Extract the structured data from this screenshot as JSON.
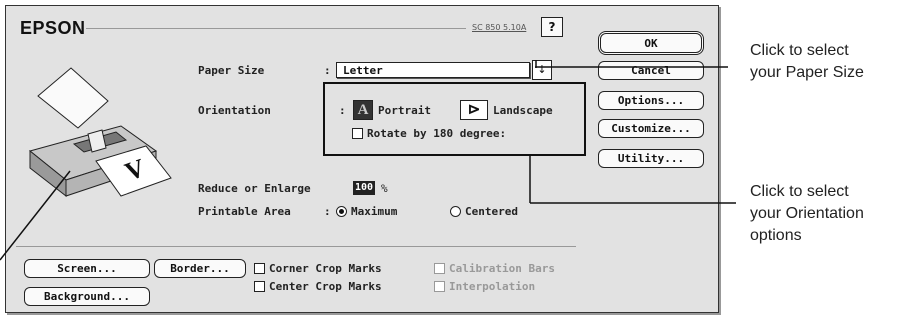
{
  "dialog": {
    "brand": "EPSON",
    "version": "SC 850 5.10A",
    "help_label": "?",
    "paper_size_label": "Paper Size",
    "paper_size_colon": ":",
    "paper_size_value": "Letter",
    "orientation_label": "Orientation",
    "orientation_colon": ":",
    "portrait_label": "Portrait",
    "landscape_label": "Landscape",
    "rotate_label": "Rotate by 180 degree:",
    "reduce_label": "Reduce or Enlarge",
    "reduce_value": "100",
    "reduce_unit": "%",
    "printable_label": "Printable Area",
    "printable_colon": ":",
    "printable_options": [
      "Maximum",
      "Centered"
    ],
    "printable_selected": "Maximum",
    "buttons": {
      "ok": "OK",
      "cancel": "Cancel",
      "options": "Options...",
      "customize": "Customize...",
      "utility": "Utility..."
    },
    "bottom": {
      "screen": "Screen...",
      "border": "Border...",
      "background": "Background...",
      "corner_crop": "Corner Crop Marks",
      "center_crop": "Center Crop Marks",
      "calibration": "Calibration Bars",
      "interpolation": "Interpolation"
    }
  },
  "callouts": {
    "paper_size": [
      "Click to select",
      "your Paper Size"
    ],
    "orientation": [
      "Click to select",
      "your Orientation",
      "options"
    ]
  }
}
